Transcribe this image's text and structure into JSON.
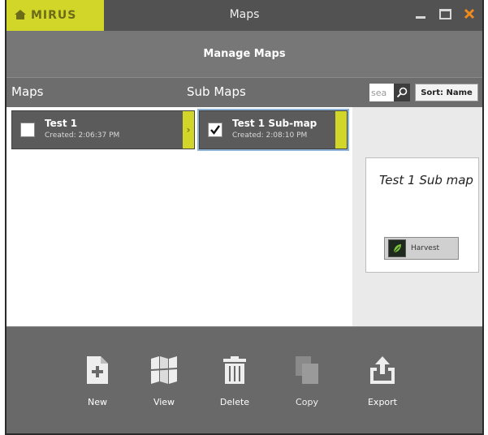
{
  "app": {
    "logo_text": "MIRUS",
    "window_title": "Maps",
    "close_color": "#f08a1c",
    "accent": "#d2d628"
  },
  "header": {
    "title": "Manage Maps"
  },
  "columns": {
    "maps": "Maps",
    "sub_maps": "Sub Maps"
  },
  "search": {
    "value": "sea",
    "placeholder": "search"
  },
  "sort": {
    "label": "Sort: Name"
  },
  "maps": [
    {
      "name": "Test 1",
      "created": "Created: 2:06:37 PM",
      "checked": false
    }
  ],
  "sub_maps": [
    {
      "name": "Test 1 Sub-map",
      "created": "Created: 2:08:10 PM",
      "checked": true
    }
  ],
  "preview": {
    "title": "Test 1 Sub map",
    "button_label": "Harvest"
  },
  "toolbar": {
    "new_label": "New",
    "view_label": "View",
    "delete_label": "Delete",
    "copy_label": "Copy",
    "export_label": "Export"
  }
}
